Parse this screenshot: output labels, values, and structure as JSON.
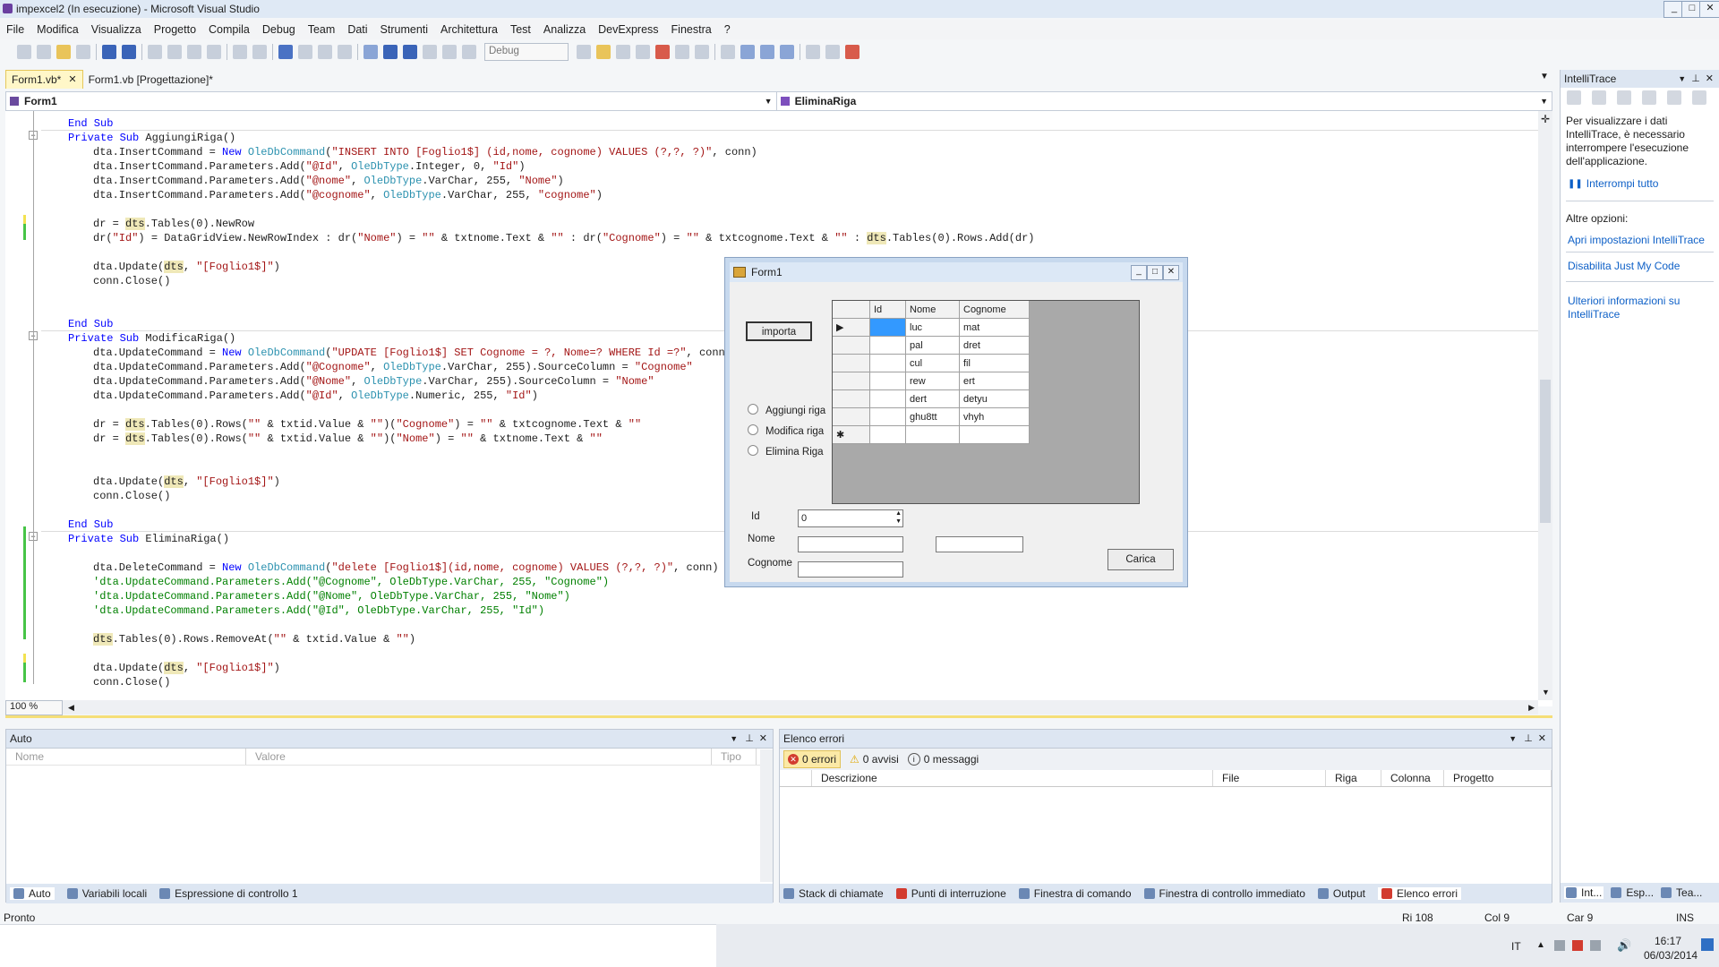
{
  "window": {
    "title": "impexcel2 (In esecuzione) - Microsoft Visual Studio"
  },
  "menu": [
    "File",
    "Modifica",
    "Visualizza",
    "Progetto",
    "Compila",
    "Debug",
    "Team",
    "Dati",
    "Strumenti",
    "Architettura",
    "Test",
    "Analizza",
    "DevExpress",
    "Finestra",
    "?"
  ],
  "toolbar": {
    "config": "Debug"
  },
  "tabs": [
    {
      "label": "Form1.vb*"
    },
    {
      "label": "Form1.vb [Progettazione]*"
    }
  ],
  "nav": {
    "left": "Form1",
    "right": "EliminaRiga"
  },
  "code_lines": [
    {
      "html": "<span class=\"kw\">End Sub</span>",
      "indent": 0
    },
    {
      "html": "<span class=\"kw\">Private Sub</span> AggiungiRiga()",
      "indent": 0
    },
    {
      "html": "dta.InsertCommand = <span class=\"kw\">New</span> <span class=\"ty\">OleDbCommand</span>(<span class=\"st\">\"INSERT INTO [Foglio1$] (id,nome, cognome) VALUES (?,?, ?)\"</span>, conn)",
      "indent": 1
    },
    {
      "html": "dta.InsertCommand.Parameters.Add(<span class=\"st\">\"@Id\"</span>, <span class=\"ty\">OleDbType</span>.Integer, 0, <span class=\"st\">\"Id\"</span>)",
      "indent": 1
    },
    {
      "html": "dta.InsertCommand.Parameters.Add(<span class=\"st\">\"@nome\"</span>, <span class=\"ty\">OleDbType</span>.VarChar, 255, <span class=\"st\">\"Nome\"</span>)",
      "indent": 1
    },
    {
      "html": "dta.InsertCommand.Parameters.Add(<span class=\"st\">\"@cognome\"</span>, <span class=\"ty\">OleDbType</span>.VarChar, 255, <span class=\"st\">\"cognome\"</span>)",
      "indent": 1
    },
    {
      "html": "",
      "indent": 1
    },
    {
      "html": "dr = <span class=\"hl\">dts</span>.Tables(0).NewRow",
      "indent": 1
    },
    {
      "html": "dr(<span class=\"st\">\"Id\"</span>) = DataGridView.NewRowIndex : dr(<span class=\"st\">\"Nome\"</span>) = <span class=\"st\">\"\"</span> &amp; txtnome.Text &amp; <span class=\"st\">\"\"</span> : dr(<span class=\"st\">\"Cognome\"</span>) = <span class=\"st\">\"\"</span> &amp; txtcognome.Text &amp; <span class=\"st\">\"\"</span> : <span class=\"hl\">dts</span>.Tables(0).Rows.Add(dr)",
      "indent": 1
    },
    {
      "html": "",
      "indent": 1
    },
    {
      "html": "dta.Update(<span class=\"hl\">dts</span>, <span class=\"st\">\"[Foglio1$]\"</span>)",
      "indent": 1
    },
    {
      "html": "conn.Close()",
      "indent": 1
    },
    {
      "html": "",
      "indent": 1
    },
    {
      "html": "",
      "indent": 1
    },
    {
      "html": "<span class=\"kw\">End Sub</span>",
      "indent": 0
    },
    {
      "html": "<span class=\"kw\">Private Sub</span> ModificaRiga()",
      "indent": 0
    },
    {
      "html": "dta.UpdateCommand = <span class=\"kw\">New</span> <span class=\"ty\">OleDbCommand</span>(<span class=\"st\">\"UPDATE [Foglio1$] SET Cognome = ?, Nome=? WHERE Id =?\"</span>, conn)",
      "indent": 1
    },
    {
      "html": "dta.UpdateCommand.Parameters.Add(<span class=\"st\">\"@Cognome\"</span>, <span class=\"ty\">OleDbType</span>.VarChar, 255).SourceColumn = <span class=\"st\">\"Cognome\"</span>",
      "indent": 1
    },
    {
      "html": "dta.UpdateCommand.Parameters.Add(<span class=\"st\">\"@Nome\"</span>, <span class=\"ty\">OleDbType</span>.VarChar, 255).SourceColumn = <span class=\"st\">\"Nome\"</span>",
      "indent": 1
    },
    {
      "html": "dta.UpdateCommand.Parameters.Add(<span class=\"st\">\"@Id\"</span>, <span class=\"ty\">OleDbType</span>.Numeric, 255, <span class=\"st\">\"Id\"</span>)",
      "indent": 1
    },
    {
      "html": "",
      "indent": 1
    },
    {
      "html": "dr = <span class=\"hl\">dts</span>.Tables(0).Rows(<span class=\"st\">\"\"</span> &amp; txtid.Value &amp; <span class=\"st\">\"\"</span>)(<span class=\"st\">\"Cognome\"</span>) = <span class=\"st\">\"\"</span> &amp; txtcognome.Text &amp; <span class=\"st\">\"\"</span>",
      "indent": 1
    },
    {
      "html": "dr = <span class=\"hl\">dts</span>.Tables(0).Rows(<span class=\"st\">\"\"</span> &amp; txtid.Value &amp; <span class=\"st\">\"\"</span>)(<span class=\"st\">\"Nome\"</span>) = <span class=\"st\">\"\"</span> &amp; txtnome.Text &amp; <span class=\"st\">\"\"</span>",
      "indent": 1
    },
    {
      "html": "",
      "indent": 1
    },
    {
      "html": "",
      "indent": 1
    },
    {
      "html": "dta.Update(<span class=\"hl\">dts</span>, <span class=\"st\">\"[Foglio1$]\"</span>)",
      "indent": 1
    },
    {
      "html": "conn.Close()",
      "indent": 1
    },
    {
      "html": "",
      "indent": 1
    },
    {
      "html": "<span class=\"kw\">End Sub</span>",
      "indent": 0
    },
    {
      "html": "<span class=\"kw\">Private Sub</span> EliminaRiga()",
      "indent": 0
    },
    {
      "html": "",
      "indent": 1
    },
    {
      "html": "dta.DeleteCommand = <span class=\"kw\">New</span> <span class=\"ty\">OleDbCommand</span>(<span class=\"st\">\"delete [Foglio1$](id,nome, cognome) VALUES (?,?, ?)\"</span>, conn)",
      "indent": 1
    },
    {
      "html": "<span class=\"cm\">'dta.UpdateCommand.Parameters.Add(\"@Cognome\", OleDbType.VarChar, 255, \"Cognome\")</span>",
      "indent": 1
    },
    {
      "html": "<span class=\"cm\">'dta.UpdateCommand.Parameters.Add(\"@Nome\", OleDbType.VarChar, 255, \"Nome\")</span>",
      "indent": 1
    },
    {
      "html": "<span class=\"cm\">'dta.UpdateCommand.Parameters.Add(\"@Id\", OleDbType.VarChar, 255, \"Id\")</span>",
      "indent": 1
    },
    {
      "html": "",
      "indent": 1
    },
    {
      "html": "<span class=\"hl\">dts</span>.Tables(0).Rows.RemoveAt(<span class=\"st\">\"\"</span> &amp; txtid.Value &amp; <span class=\"st\">\"\"</span>)",
      "indent": 1
    },
    {
      "html": "",
      "indent": 1
    },
    {
      "html": "dta.Update(<span class=\"hl\">dts</span>, <span class=\"st\">\"[Foglio1$]\"</span>)",
      "indent": 1
    },
    {
      "html": "conn.Close()",
      "indent": 1
    }
  ],
  "zoom": "100 %",
  "form1": {
    "title": "Form1",
    "import_button": "importa",
    "radios": [
      "Aggiungi riga",
      "Modifica riga",
      "Elimina Riga"
    ],
    "grid": {
      "columns": [
        "Id",
        "Nome",
        "Cognome"
      ],
      "rows": [
        [
          "",
          "luc",
          "mat"
        ],
        [
          "",
          "pal",
          "dret"
        ],
        [
          "",
          "cul",
          "fil"
        ],
        [
          "",
          "rew",
          "ert"
        ],
        [
          "",
          "dert",
          "detyu"
        ],
        [
          "",
          "ghu8tt",
          "vhyh"
        ]
      ]
    },
    "id_label": "Id",
    "id_value": "0",
    "nome_label": "Nome",
    "cognome_label": "Cognome",
    "load_button": "Carica"
  },
  "intellitrace": {
    "title": "IntelliTrace",
    "message": "Per visualizzare i dati IntelliTrace, è necessario interrompere l'esecuzione dell'applicazione.",
    "break_all": "Interrompi tutto",
    "other_options": "Altre opzioni:",
    "links": [
      "Apri impostazioni IntelliTrace",
      "Disabilita Just My Code",
      "Ulteriori informazioni su IntelliTrace"
    ],
    "bottom_tabs": [
      "Int...",
      "Esp...",
      "Tea..."
    ]
  },
  "auto_panel": {
    "title": "Auto",
    "columns": [
      "Nome",
      "Valore",
      "Tipo"
    ],
    "tabs": [
      "Auto",
      "Variabili locali",
      "Espressione di controllo 1"
    ]
  },
  "errors_panel": {
    "title": "Elenco errori",
    "filters": [
      "0 errori",
      "0 avvisi",
      "0 messaggi"
    ],
    "columns": [
      "Descrizione",
      "File",
      "Riga",
      "Colonna",
      "Progetto"
    ],
    "tabs": [
      "Stack di chiamate",
      "Punti di interruzione",
      "Finestra di comando",
      "Finestra di controllo immediato",
      "Output",
      "Elenco errori"
    ]
  },
  "status": {
    "ready": "Pronto",
    "row": "Ri 108",
    "col": "Col 9",
    "char": "Car 9",
    "ins": "INS"
  },
  "taskbar": {
    "lang": "IT",
    "time": "16:17",
    "date": "06/03/2014"
  }
}
